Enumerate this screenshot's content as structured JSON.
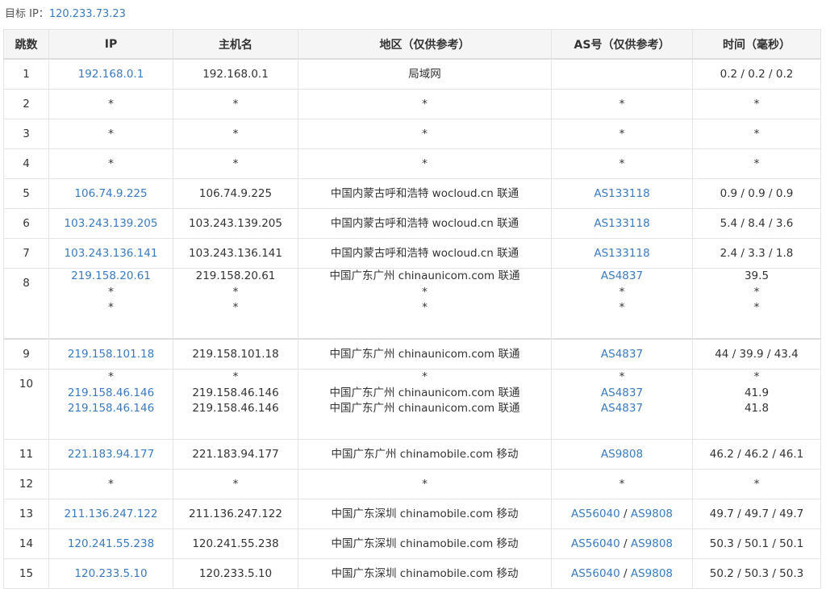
{
  "target": {
    "label": "目标 IP：",
    "ip": "120.233.73.23"
  },
  "columns": [
    "跳数",
    "IP",
    "主机名",
    "地区（仅供参考）",
    "AS号（仅供参考）",
    "时间（毫秒）"
  ],
  "rows": [
    {
      "hop": "1",
      "entries": [
        {
          "ip": "192.168.0.1",
          "host": "192.168.0.1",
          "region": "局域网",
          "as": [],
          "time": "0.2 / 0.2 / 0.2"
        }
      ]
    },
    {
      "hop": "2",
      "entries": [
        {
          "ip": "*",
          "host": "*",
          "region": "*",
          "as": [
            "*"
          ],
          "time": "*"
        }
      ]
    },
    {
      "hop": "3",
      "entries": [
        {
          "ip": "*",
          "host": "*",
          "region": "*",
          "as": [
            "*"
          ],
          "time": "*"
        }
      ]
    },
    {
      "hop": "4",
      "entries": [
        {
          "ip": "*",
          "host": "*",
          "region": "*",
          "as": [
            "*"
          ],
          "time": "*"
        }
      ]
    },
    {
      "hop": "5",
      "entries": [
        {
          "ip": "106.74.9.225",
          "host": "106.74.9.225",
          "region": "中国内蒙古呼和浩特 wocloud.cn 联通",
          "as": [
            "AS133118"
          ],
          "time": "0.9 / 0.9 / 0.9"
        }
      ]
    },
    {
      "hop": "6",
      "entries": [
        {
          "ip": "103.243.139.205",
          "host": "103.243.139.205",
          "region": "中国内蒙古呼和浩特 wocloud.cn 联通",
          "as": [
            "AS133118"
          ],
          "time": "5.4 / 8.4 / 3.6"
        }
      ]
    },
    {
      "hop": "7",
      "entries": [
        {
          "ip": "103.243.136.141",
          "host": "103.243.136.141",
          "region": "中国内蒙古呼和浩特 wocloud.cn 联通",
          "as": [
            "AS133118"
          ],
          "time": "2.4 / 3.3 / 1.8"
        }
      ]
    },
    {
      "hop": "8",
      "entries": [
        {
          "ip": "219.158.20.61",
          "host": "219.158.20.61",
          "region": "中国广东广州 chinaunicom.com 联通",
          "as": [
            "AS4837"
          ],
          "time": "39.5"
        },
        {
          "ip": "*",
          "host": "*",
          "region": "*",
          "as": [
            "*"
          ],
          "time": "*"
        },
        {
          "ip": "*",
          "host": "*",
          "region": "*",
          "as": [
            "*"
          ],
          "time": "*"
        }
      ]
    },
    {
      "hop": "9",
      "entries": [
        {
          "ip": "219.158.101.18",
          "host": "219.158.101.18",
          "region": "中国广东广州 chinaunicom.com 联通",
          "as": [
            "AS4837"
          ],
          "time": "44 / 39.9 / 43.4"
        }
      ]
    },
    {
      "hop": "10",
      "entries": [
        {
          "ip": "*",
          "host": "*",
          "region": "*",
          "as": [
            "*"
          ],
          "time": "*"
        },
        {
          "ip": "219.158.46.146",
          "host": "219.158.46.146",
          "region": "中国广东广州 chinaunicom.com 联通",
          "as": [
            "AS4837"
          ],
          "time": "41.9"
        },
        {
          "ip": "219.158.46.146",
          "host": "219.158.46.146",
          "region": "中国广东广州 chinaunicom.com 联通",
          "as": [
            "AS4837"
          ],
          "time": "41.8"
        }
      ]
    },
    {
      "hop": "11",
      "entries": [
        {
          "ip": "221.183.94.177",
          "host": "221.183.94.177",
          "region": "中国广东广州 chinamobile.com 移动",
          "as": [
            "AS9808"
          ],
          "time": "46.2 / 46.2 / 46.1"
        }
      ]
    },
    {
      "hop": "12",
      "entries": [
        {
          "ip": "*",
          "host": "*",
          "region": "*",
          "as": [
            "*"
          ],
          "time": "*"
        }
      ]
    },
    {
      "hop": "13",
      "entries": [
        {
          "ip": "211.136.247.122",
          "host": "211.136.247.122",
          "region": "中国广东深圳 chinamobile.com 移动",
          "as": [
            "AS56040",
            "AS9808"
          ],
          "time": "49.7 / 49.7 / 49.7"
        }
      ]
    },
    {
      "hop": "14",
      "entries": [
        {
          "ip": "120.241.55.238",
          "host": "120.241.55.238",
          "region": "中国广东深圳 chinamobile.com 移动",
          "as": [
            "AS56040",
            "AS9808"
          ],
          "time": "50.3 / 50.1 / 50.1"
        }
      ]
    },
    {
      "hop": "15",
      "entries": [
        {
          "ip": "120.233.5.10",
          "host": "120.233.5.10",
          "region": "中国广东深圳 chinamobile.com 移动",
          "as": [
            "AS56040",
            "AS9808"
          ],
          "time": "50.2 / 50.3 / 50.3"
        }
      ]
    }
  ]
}
